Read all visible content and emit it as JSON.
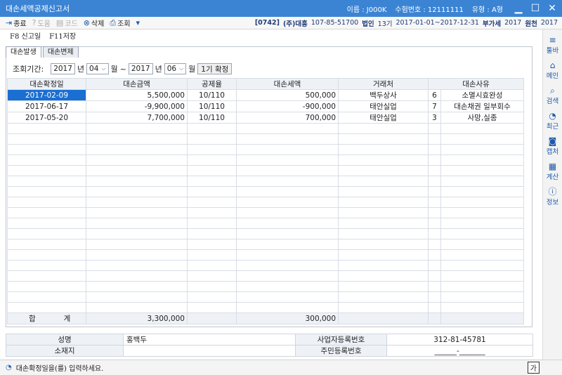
{
  "window": {
    "title": "대손세액공제신고서",
    "name_label": "이름 : J000K",
    "exam_label": "수험번호 : 12111111",
    "type_label": "유형 : A형"
  },
  "toolbar": {
    "close": "종료",
    "help": "도움",
    "code": "코드",
    "delete": "삭제",
    "search": "조회",
    "company_code": "[0742]",
    "company_name": "(주)대흥",
    "biz_no": "107-85-51700",
    "corp": "법인",
    "period_no": "13기",
    "period_range": "2017-01-01~2017-12-31",
    "vat": "부가세",
    "year": "2017",
    "source": "원천",
    "source_year": "2017"
  },
  "fkeys": {
    "f8_key": "F8",
    "f8_label": "신고일",
    "f11_key": "F11",
    "f11_label": "저장"
  },
  "sidebar": [
    {
      "icon": "menu-icon",
      "glyph": "≡",
      "label": "툴바"
    },
    {
      "icon": "home-icon",
      "glyph": "⌂",
      "label": "메인"
    },
    {
      "icon": "search-icon",
      "glyph": "⌕",
      "label": "검색"
    },
    {
      "icon": "clock-icon",
      "glyph": "◔",
      "label": "최근"
    },
    {
      "icon": "camera-icon",
      "glyph": "◙",
      "label": "캡처"
    },
    {
      "icon": "calculator-icon",
      "glyph": "▦",
      "label": "계산"
    },
    {
      "icon": "info-icon",
      "glyph": "ⓘ",
      "label": "정보"
    }
  ],
  "tabs": [
    "대손발생",
    "대손변제"
  ],
  "period": {
    "label": "조회기간:",
    "from_year": "2017",
    "year_unit": "년",
    "from_month": "04",
    "month_unit": "월",
    "tilde": "~",
    "to_year": "2017",
    "to_month": "06",
    "quarter": "1기 확정"
  },
  "grid": {
    "headers": [
      "대손확정일",
      "대손금액",
      "공제율",
      "대손세액",
      "거래처",
      "대손사유"
    ],
    "rows": [
      {
        "date": "2017-02-09",
        "amount": "5,500,000",
        "rate": "10/110",
        "tax": "500,000",
        "client": "백두상사",
        "reason_code": "6",
        "reason": "소멸시효완성"
      },
      {
        "date": "2017-06-17",
        "amount": "-9,900,000",
        "rate": "10/110",
        "tax": "-900,000",
        "client": "태안실업",
        "reason_code": "7",
        "reason": "대손채권 일부회수"
      },
      {
        "date": "2017-05-20",
        "amount": "7,700,000",
        "rate": "10/110",
        "tax": "700,000",
        "client": "태안실업",
        "reason_code": "3",
        "reason": "사망,실종"
      }
    ],
    "total_label_1": "합",
    "total_label_2": "계",
    "total_amount": "3,300,000",
    "total_tax": "300,000"
  },
  "client_info": {
    "name_label": "성명",
    "name_value": "홍백두",
    "biz_label": "사업자등록번호",
    "biz_value": "312-81-45781",
    "address_label": "소재지",
    "address_value": "",
    "rrn_label": "주민등록번호",
    "rrn_value": "______-_______"
  },
  "status": {
    "message": "대손확정일을(를) 입력하세요.",
    "ime": "가"
  }
}
